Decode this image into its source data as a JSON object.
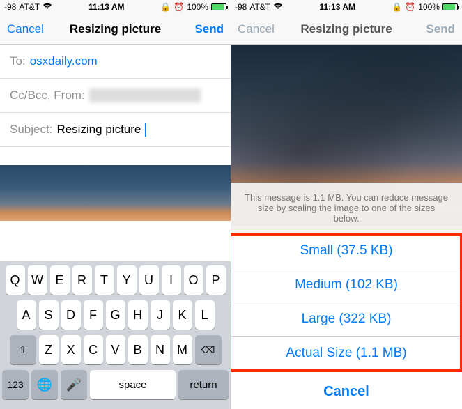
{
  "status": {
    "signal": "-98",
    "carrier": "AT&T",
    "time": "11:13 AM",
    "alarm_icon": "⏰",
    "battery_pct": "100%"
  },
  "nav": {
    "cancel": "Cancel",
    "title": "Resizing picture",
    "send": "Send"
  },
  "compose": {
    "to_label": "To:",
    "to_value": "osxdaily.com",
    "ccbcc_label": "Cc/Bcc, From:",
    "subject_label": "Subject:",
    "subject_value": "Resizing picture"
  },
  "keyboard": {
    "row1": [
      "Q",
      "W",
      "E",
      "R",
      "T",
      "Y",
      "U",
      "I",
      "O",
      "P"
    ],
    "row2": [
      "A",
      "S",
      "D",
      "F",
      "G",
      "H",
      "J",
      "K",
      "L"
    ],
    "row3": [
      "Z",
      "X",
      "C",
      "V",
      "B",
      "N",
      "M"
    ],
    "shift": "⇧",
    "delete": "⌫",
    "numbers": "123",
    "globe": "🌐",
    "mic": "🎤",
    "space": "space",
    "return": "return"
  },
  "sheet": {
    "message": "This message is 1.1 MB. You can reduce message size by scaling the image to one of the sizes below.",
    "options": [
      "Small (37.5 KB)",
      "Medium (102 KB)",
      "Large (322 KB)",
      "Actual Size (1.1 MB)"
    ],
    "cancel": "Cancel"
  }
}
